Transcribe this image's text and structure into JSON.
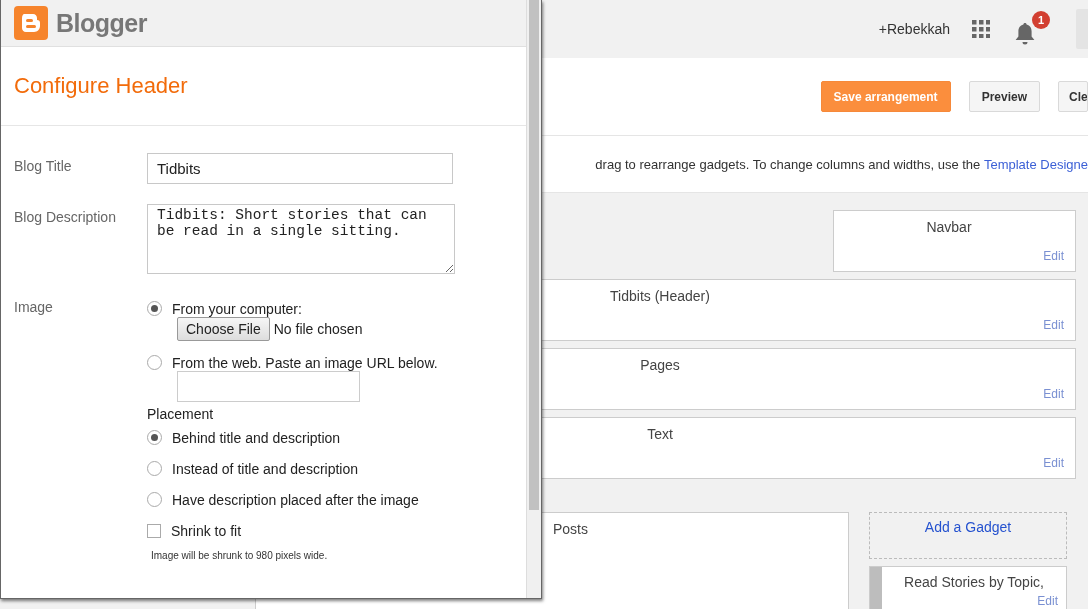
{
  "topbar": {
    "user": "+Rebekkah",
    "notifications": "1"
  },
  "toolbar": {
    "buttons": [
      {
        "label": "Save arrangement",
        "kind": "primary"
      },
      {
        "label": "Preview",
        "kind": "default"
      },
      {
        "label": "Cle",
        "kind": "default"
      }
    ]
  },
  "info": {
    "text": "drag to rearrange gadgets. To change columns and widths, use the ",
    "link": "Template Designe"
  },
  "gadgets": [
    {
      "title": "Navbar",
      "edit": "Edit",
      "kind": "narrow"
    },
    {
      "title": "Tidbits (Header)",
      "edit": "Edit",
      "kind": "wide"
    },
    {
      "title": "Pages",
      "edit": "Edit",
      "kind": "wide"
    },
    {
      "title": "Text",
      "edit": "Edit",
      "kind": "wide"
    }
  ],
  "main_column": {
    "title": "Posts"
  },
  "sidebar": {
    "add": "Add a Gadget",
    "gadgets": [
      {
        "title": "Read Stories by Topic,",
        "edit": "Edit"
      }
    ]
  },
  "popup": {
    "brand": "Blogger",
    "title": "Configure Header",
    "fields": [
      {
        "label": "Blog Title",
        "kind": "input",
        "value": "Tidbits"
      },
      {
        "label": "Blog Description",
        "kind": "textarea",
        "value": "Tidbits: Short stories that can be read in a single sitting."
      }
    ],
    "image": {
      "label": "Image",
      "sources": [
        {
          "label": "From your computer:",
          "selected": true,
          "kind": "file",
          "button": "Choose File",
          "status": "No file chosen"
        },
        {
          "label": "From the web. Paste an image URL below.",
          "selected": false,
          "kind": "url"
        }
      ],
      "placement_heading": "Placement",
      "placements": [
        {
          "label": "Behind title and description",
          "selected": true
        },
        {
          "label": "Instead of title and description",
          "selected": false
        },
        {
          "label": "Have description placed after the image",
          "selected": false
        }
      ],
      "shrink": {
        "label": "Shrink to fit",
        "checked": false
      },
      "note": "Image will be shrunk to 980 pixels wide."
    }
  }
}
